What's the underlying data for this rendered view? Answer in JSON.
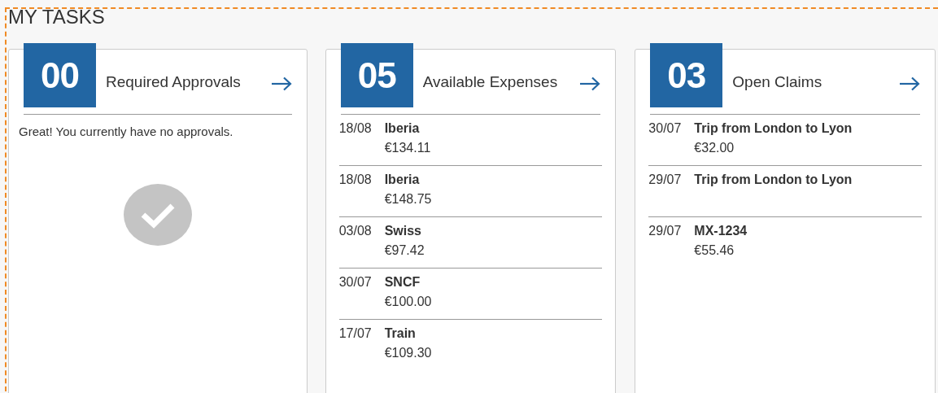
{
  "title": "MY TASKS",
  "cards": [
    {
      "count": "00",
      "label": "Required Approvals",
      "message": "Great! You currently have no approvals."
    },
    {
      "count": "05",
      "label": "Available Expenses",
      "items": [
        {
          "date": "18/08",
          "name": "Iberia",
          "amount": "€134.11"
        },
        {
          "date": "18/08",
          "name": "Iberia",
          "amount": "€148.75"
        },
        {
          "date": "03/08",
          "name": "Swiss",
          "amount": "€97.42"
        },
        {
          "date": "30/07",
          "name": "SNCF",
          "amount": "€100.00"
        },
        {
          "date": "17/07",
          "name": "Train",
          "amount": "€109.30"
        }
      ]
    },
    {
      "count": "03",
      "label": "Open Claims",
      "items": [
        {
          "date": "30/07",
          "name": "Trip from London to Lyon",
          "amount": "€32.00"
        },
        {
          "date": "29/07",
          "name": "Trip from London to Lyon"
        },
        {
          "date": "29/07",
          "name": "MX-1234",
          "amount": "€55.46"
        }
      ]
    }
  ]
}
